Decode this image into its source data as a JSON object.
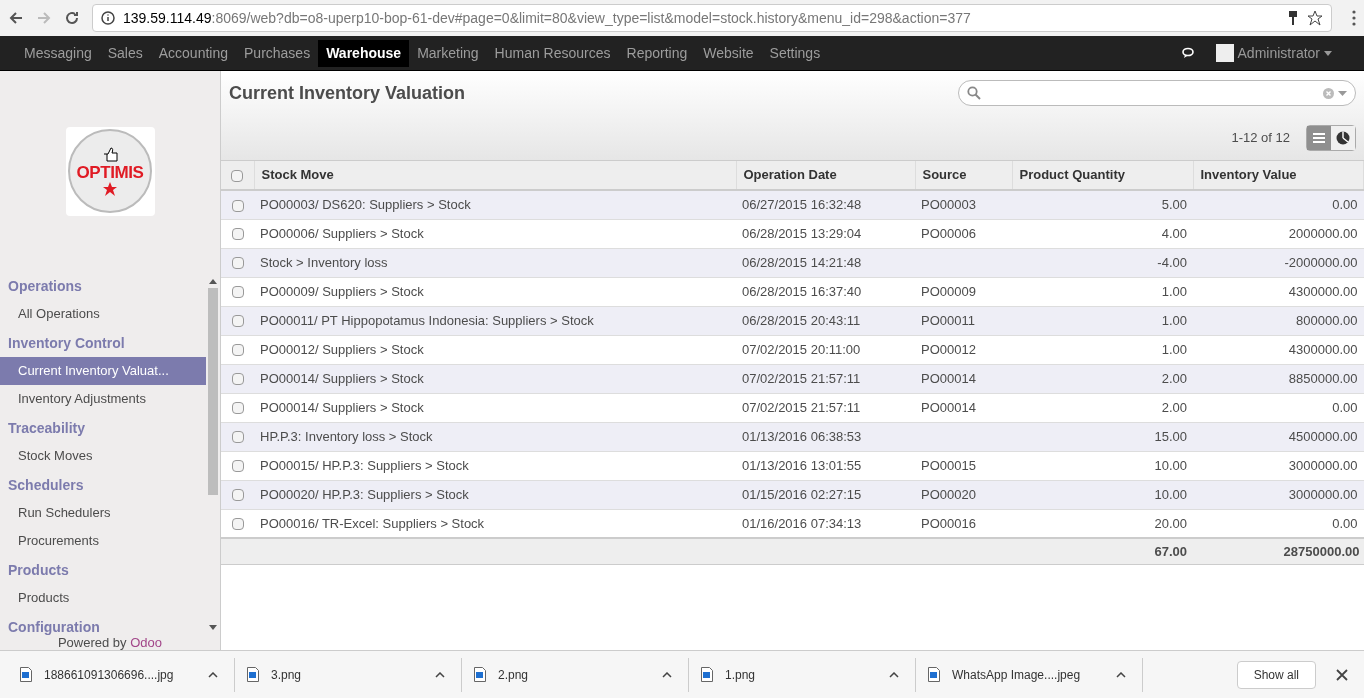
{
  "browser": {
    "url_host": "139.59.114.49",
    "url_rest": ":8069/web?db=o8-uperp10-bop-61-dev#page=0&limit=80&view_type=list&model=stock.history&menu_id=298&action=377"
  },
  "top_menu": [
    {
      "label": "Messaging",
      "selected": false
    },
    {
      "label": "Sales",
      "selected": false
    },
    {
      "label": "Accounting",
      "selected": false
    },
    {
      "label": "Purchases",
      "selected": false
    },
    {
      "label": "Warehouse",
      "selected": true
    },
    {
      "label": "Marketing",
      "selected": false
    },
    {
      "label": "Human Resources",
      "selected": false
    },
    {
      "label": "Reporting",
      "selected": false
    },
    {
      "label": "Website",
      "selected": false
    },
    {
      "label": "Settings",
      "selected": false
    }
  ],
  "user": "Administrator",
  "logo_text": "OPTIMIS",
  "sidebar": [
    {
      "kind": "section",
      "label": "Operations"
    },
    {
      "kind": "item",
      "label": "All Operations",
      "selected": false
    },
    {
      "kind": "section",
      "label": "Inventory Control"
    },
    {
      "kind": "item",
      "label": "Current Inventory Valuat...",
      "selected": true
    },
    {
      "kind": "item",
      "label": "Inventory Adjustments",
      "selected": false
    },
    {
      "kind": "section",
      "label": "Traceability"
    },
    {
      "kind": "item",
      "label": "Stock Moves",
      "selected": false
    },
    {
      "kind": "section",
      "label": "Schedulers"
    },
    {
      "kind": "item",
      "label": "Run Schedulers",
      "selected": false
    },
    {
      "kind": "item",
      "label": "Procurements",
      "selected": false
    },
    {
      "kind": "section",
      "label": "Products"
    },
    {
      "kind": "item",
      "label": "Products",
      "selected": false
    },
    {
      "kind": "section",
      "label": "Configuration"
    }
  ],
  "powered_by": {
    "text": "Powered by",
    "brand": "Odoo"
  },
  "title": "Current Inventory Valuation",
  "pager": "1-12 of 12",
  "table": {
    "select_all_checked": false,
    "columns": [
      "Stock Move",
      "Operation Date",
      "Source",
      "Product Quantity",
      "Inventory Value"
    ],
    "rows": [
      {
        "checked": false,
        "cells": [
          "PO00003/ DS620: Suppliers > Stock",
          "06/27/2015 16:32:48",
          "PO00003",
          "5.00",
          "0.00"
        ]
      },
      {
        "checked": false,
        "cells": [
          "PO00006/ Suppliers > Stock",
          "06/28/2015 13:29:04",
          "PO00006",
          "4.00",
          "2000000.00"
        ]
      },
      {
        "checked": false,
        "cells": [
          "Stock > Inventory loss",
          "06/28/2015 14:21:48",
          "",
          "-4.00",
          "-2000000.00"
        ]
      },
      {
        "checked": false,
        "cells": [
          "PO00009/ Suppliers > Stock",
          "06/28/2015 16:37:40",
          "PO00009",
          "1.00",
          "4300000.00"
        ]
      },
      {
        "checked": false,
        "cells": [
          "PO00011/ PT Hippopotamus Indonesia: Suppliers > Stock",
          "06/28/2015 20:43:11",
          "PO00011",
          "1.00",
          "800000.00"
        ]
      },
      {
        "checked": false,
        "cells": [
          "PO00012/ Suppliers > Stock",
          "07/02/2015 20:11:00",
          "PO00012",
          "1.00",
          "4300000.00"
        ]
      },
      {
        "checked": false,
        "cells": [
          "PO00014/ Suppliers > Stock",
          "07/02/2015 21:57:11",
          "PO00014",
          "2.00",
          "8850000.00"
        ]
      },
      {
        "checked": false,
        "cells": [
          "PO00014/ Suppliers > Stock",
          "07/02/2015 21:57:11",
          "PO00014",
          "2.00",
          "0.00"
        ]
      },
      {
        "checked": false,
        "cells": [
          "HP.P.3: Inventory loss > Stock",
          "01/13/2016 06:38:53",
          "",
          "15.00",
          "4500000.00"
        ]
      },
      {
        "checked": false,
        "cells": [
          "PO00015/ HP.P.3: Suppliers > Stock",
          "01/13/2016 13:01:55",
          "PO00015",
          "10.00",
          "3000000.00"
        ]
      },
      {
        "checked": false,
        "cells": [
          "PO00020/ HP.P.3: Suppliers > Stock",
          "01/15/2016 02:27:15",
          "PO00020",
          "10.00",
          "3000000.00"
        ]
      },
      {
        "checked": false,
        "cells": [
          "PO00016/ TR-Excel: Suppliers > Stock",
          "01/16/2016 07:34:13",
          "PO00016",
          "20.00",
          "0.00"
        ]
      }
    ],
    "totals": {
      "quantity": "67.00",
      "value": "28750000.00"
    }
  },
  "downloads": [
    "188661091306696....jpg",
    "3.png",
    "2.png",
    "1.png",
    "WhatsApp Image....jpeg"
  ],
  "show_all": "Show all"
}
